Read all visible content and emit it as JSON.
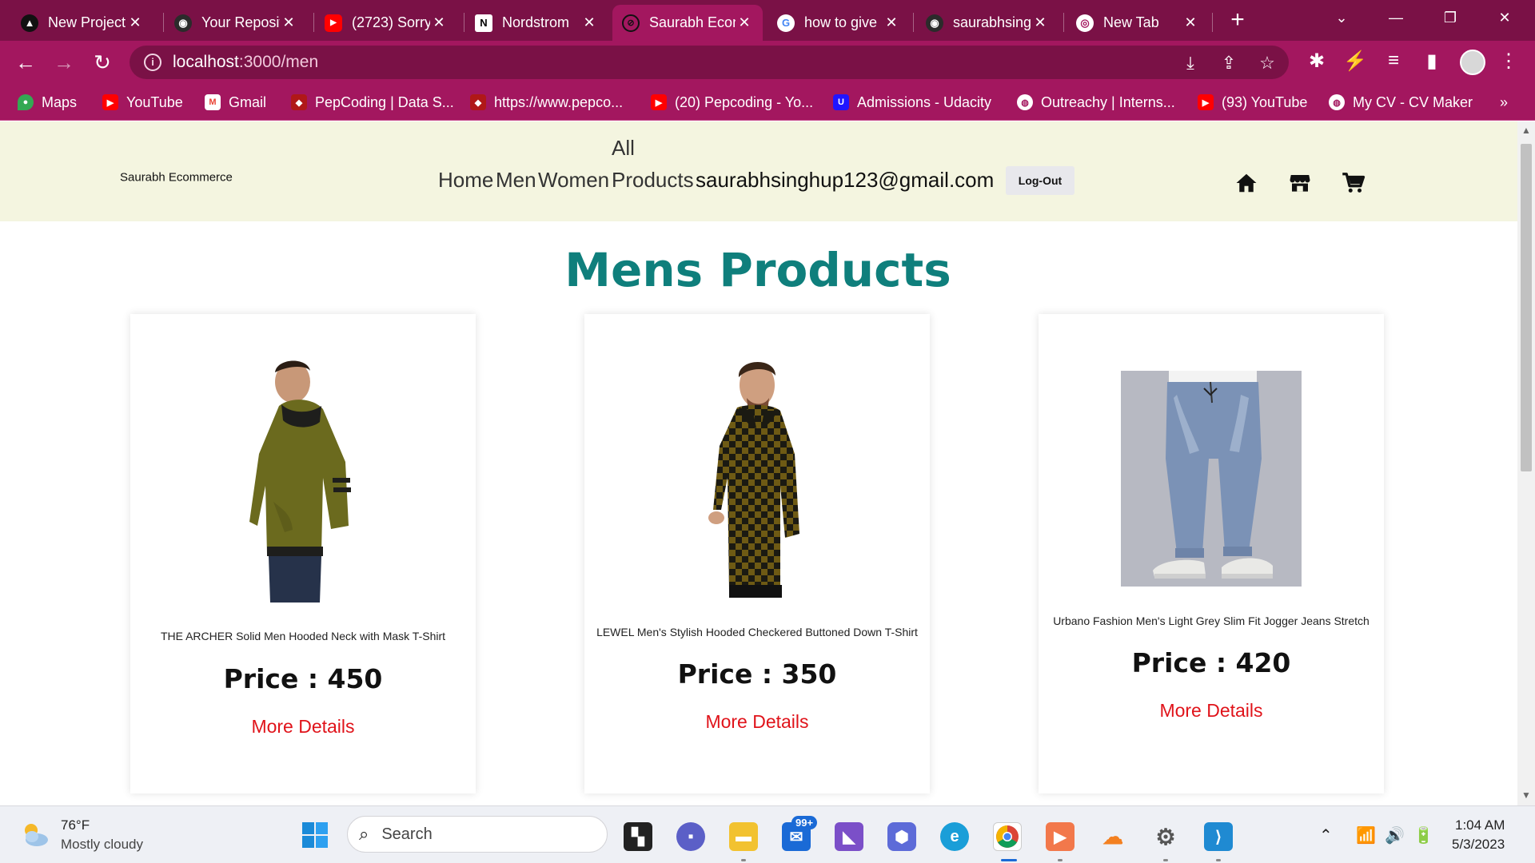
{
  "browser": {
    "tabs": [
      {
        "title": "New Project",
        "icon": "triangle-icon"
      },
      {
        "title": "Your Repositories",
        "icon": "github-icon"
      },
      {
        "title": "(2723) Sorry",
        "icon": "youtube-icon"
      },
      {
        "title": "Nordstrom",
        "icon": "nordstrom-icon"
      },
      {
        "title": "Saurabh Ecommerce",
        "icon": "compass-icon"
      },
      {
        "title": "how to give",
        "icon": "google-icon"
      },
      {
        "title": "saurabhsinghup",
        "icon": "github-icon"
      },
      {
        "title": "New Tab",
        "icon": "chrome-icon"
      }
    ],
    "active_tab": 4,
    "url_host": "localhost",
    "url_path": ":3000/men",
    "bookmarks": [
      {
        "label": "Maps",
        "icon": "maps-icon"
      },
      {
        "label": "YouTube",
        "icon": "youtube-icon"
      },
      {
        "label": "Gmail",
        "icon": "gmail-icon"
      },
      {
        "label": "PepCoding | Data S...",
        "icon": "pepcoding-icon"
      },
      {
        "label": "https://www.pepco...",
        "icon": "pepcoding-icon"
      },
      {
        "label": "(20) Pepcoding - Yo...",
        "icon": "youtube-icon"
      },
      {
        "label": "Admissions - Udacity",
        "icon": "udacity-icon"
      },
      {
        "label": "Outreachy | Interns...",
        "icon": "globe-icon"
      },
      {
        "label": "(93) YouTube",
        "icon": "youtube-icon"
      },
      {
        "label": "My CV - CV Maker",
        "icon": "globe-icon"
      }
    ],
    "bookmarks_overflow": "»"
  },
  "site": {
    "brand": "Saurabh Ecommerce",
    "nav": [
      "Home",
      "Men",
      "Women"
    ],
    "nav_all_1": "All",
    "nav_all_2": "Products",
    "email": "saurabhsinghup123@gmail.com",
    "logout": "Log-Out"
  },
  "page": {
    "heading": "Mens Products",
    "products": [
      {
        "title": "THE ARCHER Solid Men Hooded Neck with Mask T-Shirt",
        "price": "Price : 450",
        "more": "More Details"
      },
      {
        "title": "LEWEL Men's Stylish Hooded Checkered Buttoned Down T-Shirt",
        "price": "Price : 350",
        "more": "More Details"
      },
      {
        "title": "Urbano Fashion Men's Light Grey Slim Fit Jogger Jeans Stretch",
        "price": "Price : 420",
        "more": "More Details"
      }
    ]
  },
  "taskbar": {
    "weather_temp": "76°F",
    "weather_desc": "Mostly cloudy",
    "search_label": "Search",
    "mail_badge": "99+",
    "time": "1:04 AM",
    "date": "5/3/2023"
  },
  "colors": {
    "tabstrip": "#7a1146",
    "toolbar": "#a3175f",
    "header_bg": "#f4f5e0",
    "heading": "#0f7f7c",
    "link_red": "#e0131a"
  }
}
